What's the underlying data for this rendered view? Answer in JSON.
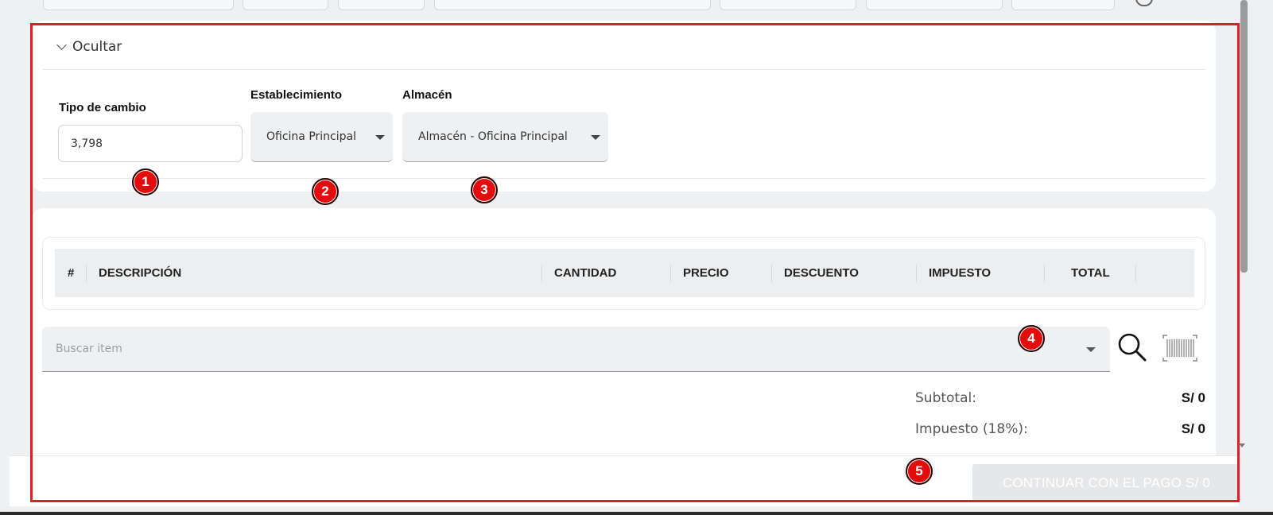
{
  "section_toggle": {
    "label": "Ocultar"
  },
  "fields": {
    "exchange_rate": {
      "label": "Tipo de cambio",
      "value": "3,798"
    },
    "establishment": {
      "label": "Establecimiento",
      "value": "Oficina Principal"
    },
    "warehouse": {
      "label": "Almacén",
      "value": "Almacén - Oficina Principal"
    }
  },
  "table": {
    "columns": [
      "#",
      "DESCRIPCIÓN",
      "CANTIDAD",
      "PRECIO",
      "DESCUENTO",
      "IMPUESTO",
      "TOTAL"
    ]
  },
  "search": {
    "placeholder": "Buscar item"
  },
  "icons": {
    "search": "magnifier-icon",
    "barcode": "barcode-icon",
    "toggle": "chevron-down-icon"
  },
  "totals": {
    "subtotal_label": "Subtotal:",
    "subtotal_value": "S/ 0",
    "tax_label": "Impuesto (18%):",
    "tax_value": "S/ 0"
  },
  "actions": {
    "pay_label": "CONTINUAR CON EL PAGO S/ 0"
  },
  "annotations": [
    "1",
    "2",
    "3",
    "4",
    "5"
  ],
  "colors": {
    "annotation_red": "#e01e26",
    "disabled_button": "#e6e7e9"
  }
}
